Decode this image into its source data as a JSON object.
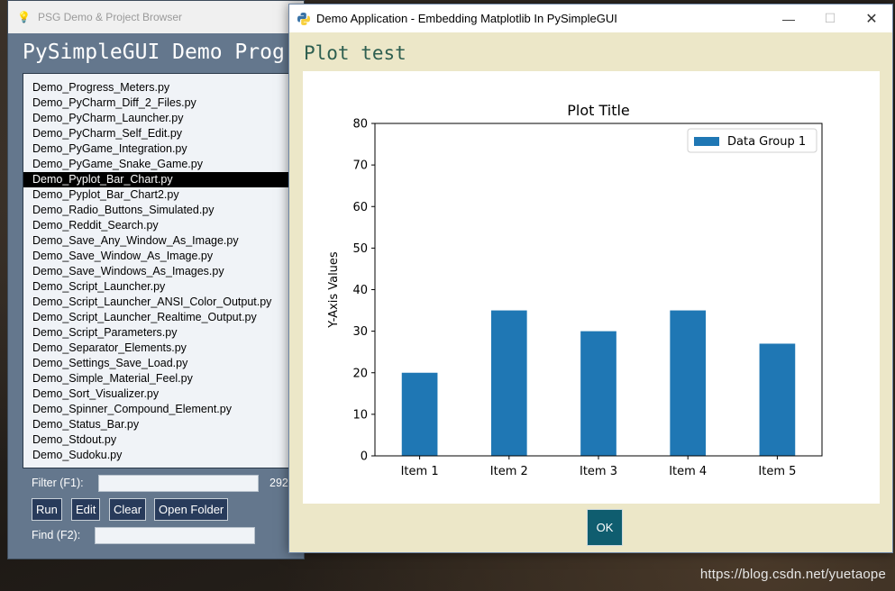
{
  "background_window": {
    "title": "PSG Demo & Project Browser",
    "heading": "PySimpleGUI Demo Prog",
    "files": [
      "Demo_Progress_Meters.py",
      "Demo_PyCharm_Diff_2_Files.py",
      "Demo_PyCharm_Launcher.py",
      "Demo_PyCharm_Self_Edit.py",
      "Demo_PyGame_Integration.py",
      "Demo_PyGame_Snake_Game.py",
      "Demo_Pyplot_Bar_Chart.py",
      "Demo_Pyplot_Bar_Chart2.py",
      "Demo_Radio_Buttons_Simulated.py",
      "Demo_Reddit_Search.py",
      "Demo_Save_Any_Window_As_Image.py",
      "Demo_Save_Window_As_Image.py",
      "Demo_Save_Windows_As_Images.py",
      "Demo_Script_Launcher.py",
      "Demo_Script_Launcher_ANSI_Color_Output.py",
      "Demo_Script_Launcher_Realtime_Output.py",
      "Demo_Script_Parameters.py",
      "Demo_Separator_Elements.py",
      "Demo_Settings_Save_Load.py",
      "Demo_Simple_Material_Feel.py",
      "Demo_Sort_Visualizer.py",
      "Demo_Spinner_Compound_Element.py",
      "Demo_Status_Bar.py",
      "Demo_Stdout.py",
      "Demo_Sudoku.py"
    ],
    "selected_file": "Demo_Pyplot_Bar_Chart.py",
    "filter_label": "Filter (F1):",
    "filter_value": "",
    "count_text": "292",
    "find_label": "Find (F2):",
    "find_value": "",
    "buttons": {
      "run": "Run",
      "edit": "Edit",
      "clear": "Clear",
      "open_folder": "Open Folder"
    }
  },
  "foreground_window": {
    "title": "Demo Application - Embedding Matplotlib In PySimpleGUI",
    "plot_label": "Plot test",
    "ok_label": "OK",
    "controls": {
      "minimize": "—",
      "maximize": "☐",
      "close": "✕"
    }
  },
  "chart_data": {
    "type": "bar",
    "title": "Plot Title",
    "xlabel": "",
    "ylabel": "Y-Axis Values",
    "categories": [
      "Item 1",
      "Item 2",
      "Item 3",
      "Item 4",
      "Item 5"
    ],
    "series": [
      {
        "name": "Data Group 1",
        "values": [
          20,
          35,
          30,
          35,
          27
        ],
        "color": "#1f77b4"
      }
    ],
    "ylim": [
      0,
      80
    ],
    "yticks": [
      0,
      10,
      20,
      30,
      40,
      50,
      60,
      70,
      80
    ],
    "grid": false,
    "legend": "top-right"
  },
  "watermark": "https://blog.csdn.net/yuetaope"
}
